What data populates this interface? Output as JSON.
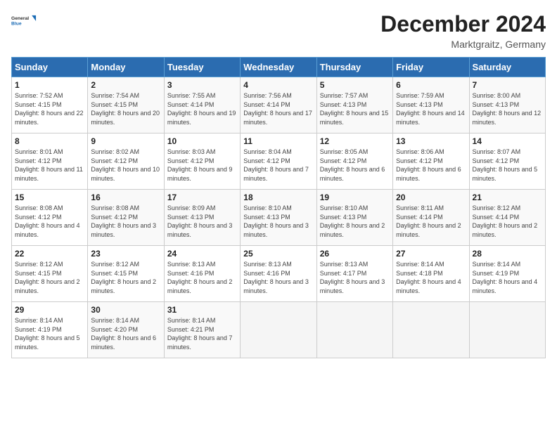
{
  "logo": {
    "line1": "General",
    "line2": "Blue"
  },
  "title": "December 2024",
  "location": "Marktgraitz, Germany",
  "days_of_week": [
    "Sunday",
    "Monday",
    "Tuesday",
    "Wednesday",
    "Thursday",
    "Friday",
    "Saturday"
  ],
  "weeks": [
    [
      {
        "num": "1",
        "rise": "7:52 AM",
        "set": "4:15 PM",
        "daylight": "8 hours and 22 minutes."
      },
      {
        "num": "2",
        "rise": "7:54 AM",
        "set": "4:15 PM",
        "daylight": "8 hours and 20 minutes."
      },
      {
        "num": "3",
        "rise": "7:55 AM",
        "set": "4:14 PM",
        "daylight": "8 hours and 19 minutes."
      },
      {
        "num": "4",
        "rise": "7:56 AM",
        "set": "4:14 PM",
        "daylight": "8 hours and 17 minutes."
      },
      {
        "num": "5",
        "rise": "7:57 AM",
        "set": "4:13 PM",
        "daylight": "8 hours and 15 minutes."
      },
      {
        "num": "6",
        "rise": "7:59 AM",
        "set": "4:13 PM",
        "daylight": "8 hours and 14 minutes."
      },
      {
        "num": "7",
        "rise": "8:00 AM",
        "set": "4:13 PM",
        "daylight": "8 hours and 12 minutes."
      }
    ],
    [
      {
        "num": "8",
        "rise": "8:01 AM",
        "set": "4:12 PM",
        "daylight": "8 hours and 11 minutes."
      },
      {
        "num": "9",
        "rise": "8:02 AM",
        "set": "4:12 PM",
        "daylight": "8 hours and 10 minutes."
      },
      {
        "num": "10",
        "rise": "8:03 AM",
        "set": "4:12 PM",
        "daylight": "8 hours and 9 minutes."
      },
      {
        "num": "11",
        "rise": "8:04 AM",
        "set": "4:12 PM",
        "daylight": "8 hours and 7 minutes."
      },
      {
        "num": "12",
        "rise": "8:05 AM",
        "set": "4:12 PM",
        "daylight": "8 hours and 6 minutes."
      },
      {
        "num": "13",
        "rise": "8:06 AM",
        "set": "4:12 PM",
        "daylight": "8 hours and 6 minutes."
      },
      {
        "num": "14",
        "rise": "8:07 AM",
        "set": "4:12 PM",
        "daylight": "8 hours and 5 minutes."
      }
    ],
    [
      {
        "num": "15",
        "rise": "8:08 AM",
        "set": "4:12 PM",
        "daylight": "8 hours and 4 minutes."
      },
      {
        "num": "16",
        "rise": "8:08 AM",
        "set": "4:12 PM",
        "daylight": "8 hours and 3 minutes."
      },
      {
        "num": "17",
        "rise": "8:09 AM",
        "set": "4:13 PM",
        "daylight": "8 hours and 3 minutes."
      },
      {
        "num": "18",
        "rise": "8:10 AM",
        "set": "4:13 PM",
        "daylight": "8 hours and 3 minutes."
      },
      {
        "num": "19",
        "rise": "8:10 AM",
        "set": "4:13 PM",
        "daylight": "8 hours and 2 minutes."
      },
      {
        "num": "20",
        "rise": "8:11 AM",
        "set": "4:14 PM",
        "daylight": "8 hours and 2 minutes."
      },
      {
        "num": "21",
        "rise": "8:12 AM",
        "set": "4:14 PM",
        "daylight": "8 hours and 2 minutes."
      }
    ],
    [
      {
        "num": "22",
        "rise": "8:12 AM",
        "set": "4:15 PM",
        "daylight": "8 hours and 2 minutes."
      },
      {
        "num": "23",
        "rise": "8:12 AM",
        "set": "4:15 PM",
        "daylight": "8 hours and 2 minutes."
      },
      {
        "num": "24",
        "rise": "8:13 AM",
        "set": "4:16 PM",
        "daylight": "8 hours and 2 minutes."
      },
      {
        "num": "25",
        "rise": "8:13 AM",
        "set": "4:16 PM",
        "daylight": "8 hours and 3 minutes."
      },
      {
        "num": "26",
        "rise": "8:13 AM",
        "set": "4:17 PM",
        "daylight": "8 hours and 3 minutes."
      },
      {
        "num": "27",
        "rise": "8:14 AM",
        "set": "4:18 PM",
        "daylight": "8 hours and 4 minutes."
      },
      {
        "num": "28",
        "rise": "8:14 AM",
        "set": "4:19 PM",
        "daylight": "8 hours and 4 minutes."
      }
    ],
    [
      {
        "num": "29",
        "rise": "8:14 AM",
        "set": "4:19 PM",
        "daylight": "8 hours and 5 minutes."
      },
      {
        "num": "30",
        "rise": "8:14 AM",
        "set": "4:20 PM",
        "daylight": "8 hours and 6 minutes."
      },
      {
        "num": "31",
        "rise": "8:14 AM",
        "set": "4:21 PM",
        "daylight": "8 hours and 7 minutes."
      },
      null,
      null,
      null,
      null
    ]
  ],
  "labels": {
    "sunrise": "Sunrise:",
    "sunset": "Sunset:",
    "daylight": "Daylight:"
  }
}
